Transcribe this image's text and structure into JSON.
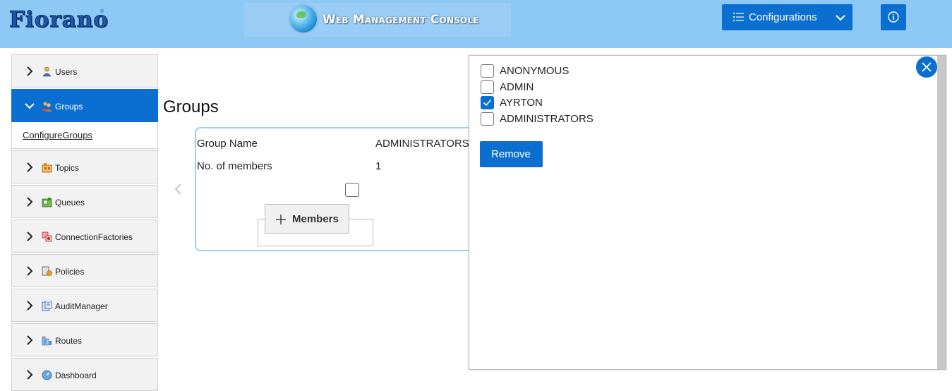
{
  "header": {
    "logo_text": "Fiorano",
    "logo_mark": "®",
    "banner_title": "Web Management Console",
    "config_label": "Configurations",
    "brand_color": "#0b6fd1",
    "header_bg": "#8ec8f5"
  },
  "sidebar": {
    "items": [
      {
        "label": "Users",
        "icon": "user-icon",
        "expanded": false
      },
      {
        "label": "Groups",
        "icon": "groups-icon",
        "expanded": true
      },
      {
        "label": "Topics",
        "icon": "topics-icon",
        "expanded": false
      },
      {
        "label": "Queues",
        "icon": "queues-icon",
        "expanded": false
      },
      {
        "label": "ConnectionFactories",
        "icon": "connection-factories-icon",
        "expanded": false
      },
      {
        "label": "Policies",
        "icon": "policies-icon",
        "expanded": false
      },
      {
        "label": "AuditManager",
        "icon": "audit-manager-icon",
        "expanded": false
      },
      {
        "label": "Routes",
        "icon": "routes-icon",
        "expanded": false
      },
      {
        "label": "Dashboard",
        "icon": "dashboard-icon",
        "expanded": false
      }
    ],
    "sub_link": "ConfigureGroups"
  },
  "main": {
    "title": "Groups",
    "rows": [
      {
        "label": "Group Name",
        "value": "ADMINISTRATORS"
      },
      {
        "label": "No. of members",
        "value": "1"
      }
    ],
    "members_button": "Members"
  },
  "popup": {
    "options": [
      {
        "label": "ANONYMOUS",
        "checked": false
      },
      {
        "label": "ADMIN",
        "checked": false
      },
      {
        "label": "AYRTON",
        "checked": true
      },
      {
        "label": "ADMINISTRATORS",
        "checked": false
      }
    ],
    "remove_label": "Remove"
  }
}
